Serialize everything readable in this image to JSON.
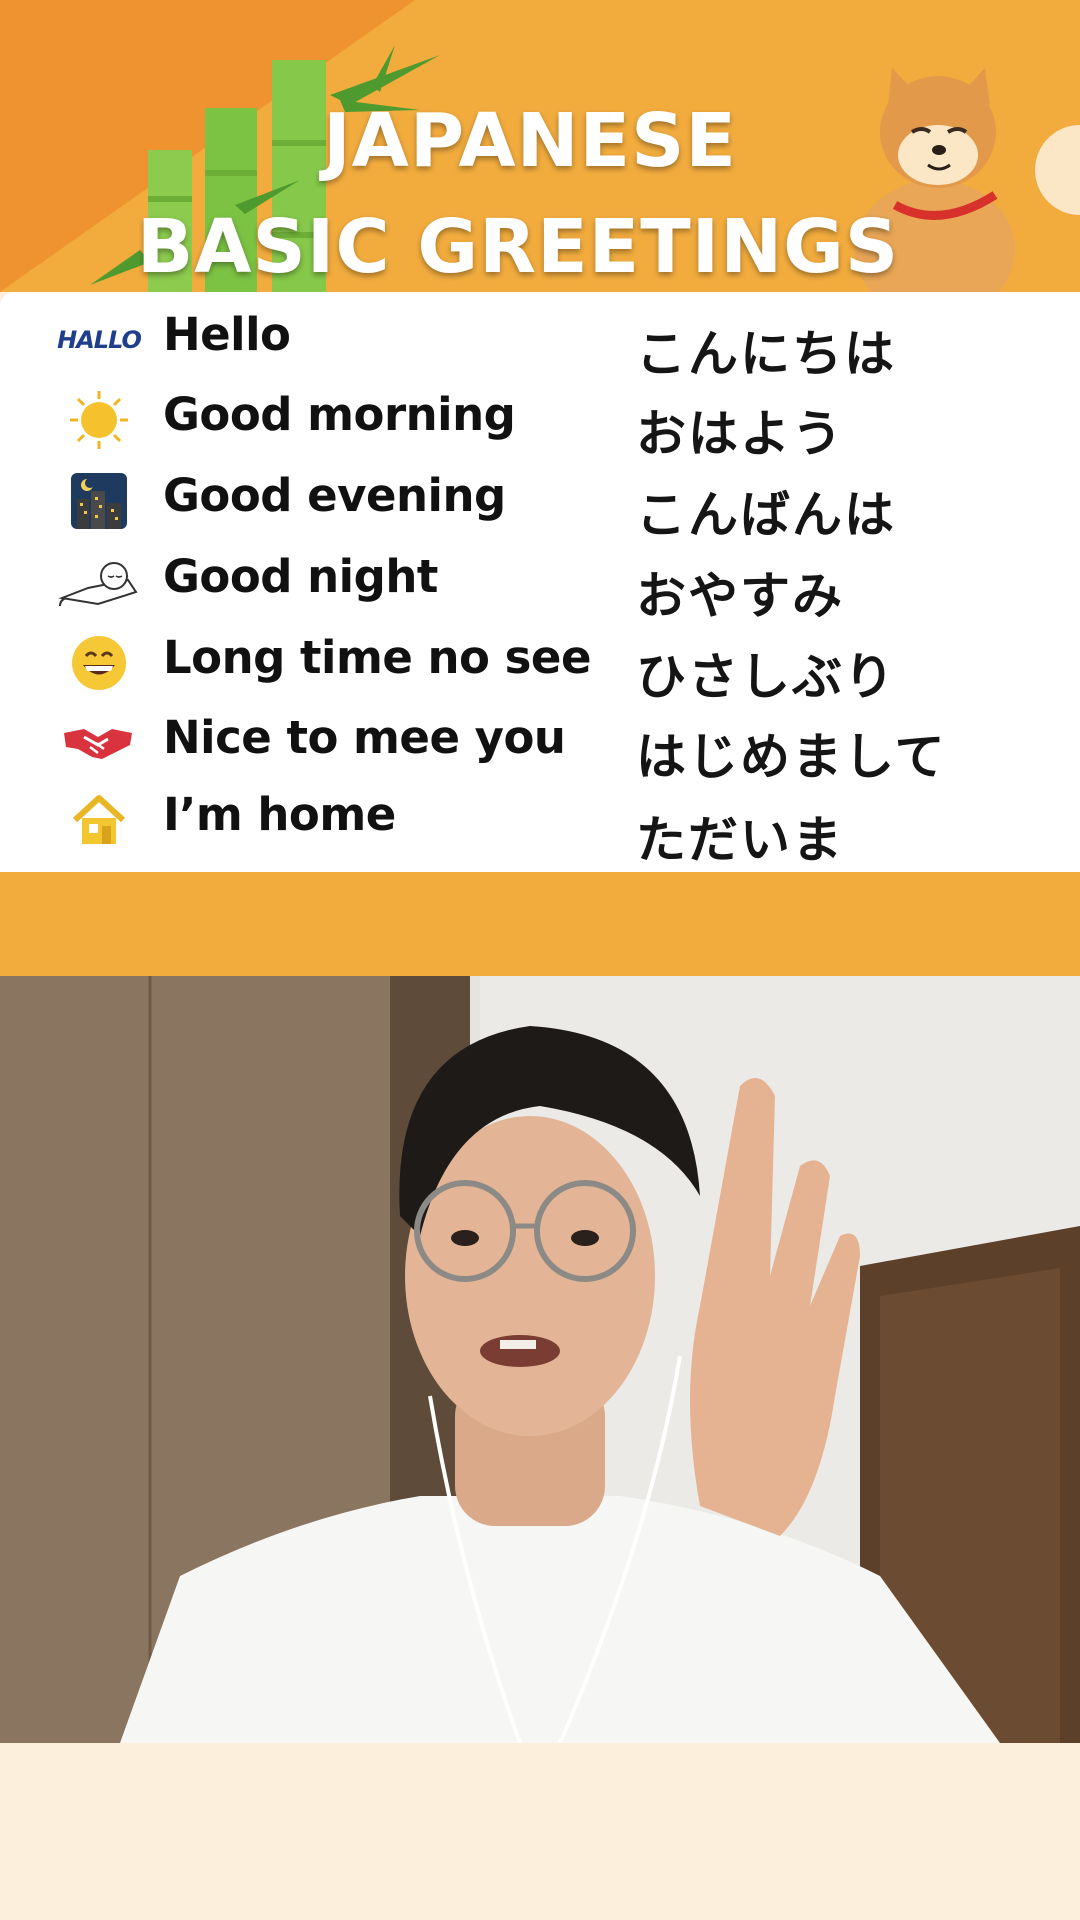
{
  "header": {
    "title_line1": "JAPANESE",
    "title_line2": "BASIC GREETINGS"
  },
  "greetings": [
    {
      "icon": "hallo-text-icon",
      "icon_text": "HALLO",
      "english": "Hello",
      "japanese": "こんにちは"
    },
    {
      "icon": "sun-icon",
      "english": "Good morning",
      "japanese": "おはよう"
    },
    {
      "icon": "night-city-icon",
      "english": "Good evening",
      "japanese": "こんばんは"
    },
    {
      "icon": "sleeping-icon",
      "english": "Good night",
      "japanese": "おやすみ"
    },
    {
      "icon": "grinning-face-icon",
      "english": "Long time no see",
      "japanese": "ひさしぶり"
    },
    {
      "icon": "handshake-icon",
      "english": "Nice to mee you",
      "japanese": "はじめまして"
    },
    {
      "icon": "house-icon",
      "english": "I’m home",
      "japanese": "ただいま"
    }
  ],
  "colors": {
    "header_orange": "#F2AC3E",
    "corner_orange": "#EE932F",
    "bamboo_green": "#7CC243",
    "card_white": "#FFFFFF",
    "bottom_cream": "#FCF0DD"
  }
}
